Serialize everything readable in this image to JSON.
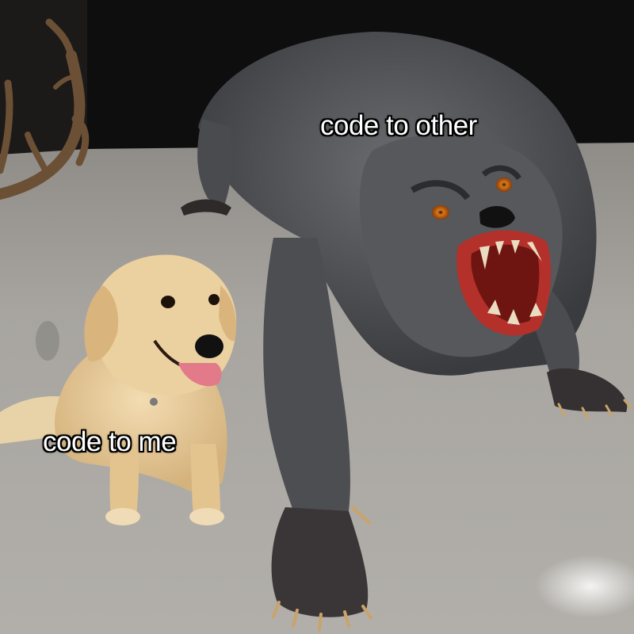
{
  "meme": {
    "top_caption": "code to other",
    "bottom_caption": "code to me"
  },
  "colors": {
    "floor": "#aaa7a2",
    "wall": "#101010",
    "creature_fur": "#55575a",
    "dog_fur": "#e6c99a",
    "mouth": "#c2352c"
  },
  "figures": {
    "left": "golden-retriever",
    "right": "werewolf-figure",
    "background": "antlers"
  }
}
